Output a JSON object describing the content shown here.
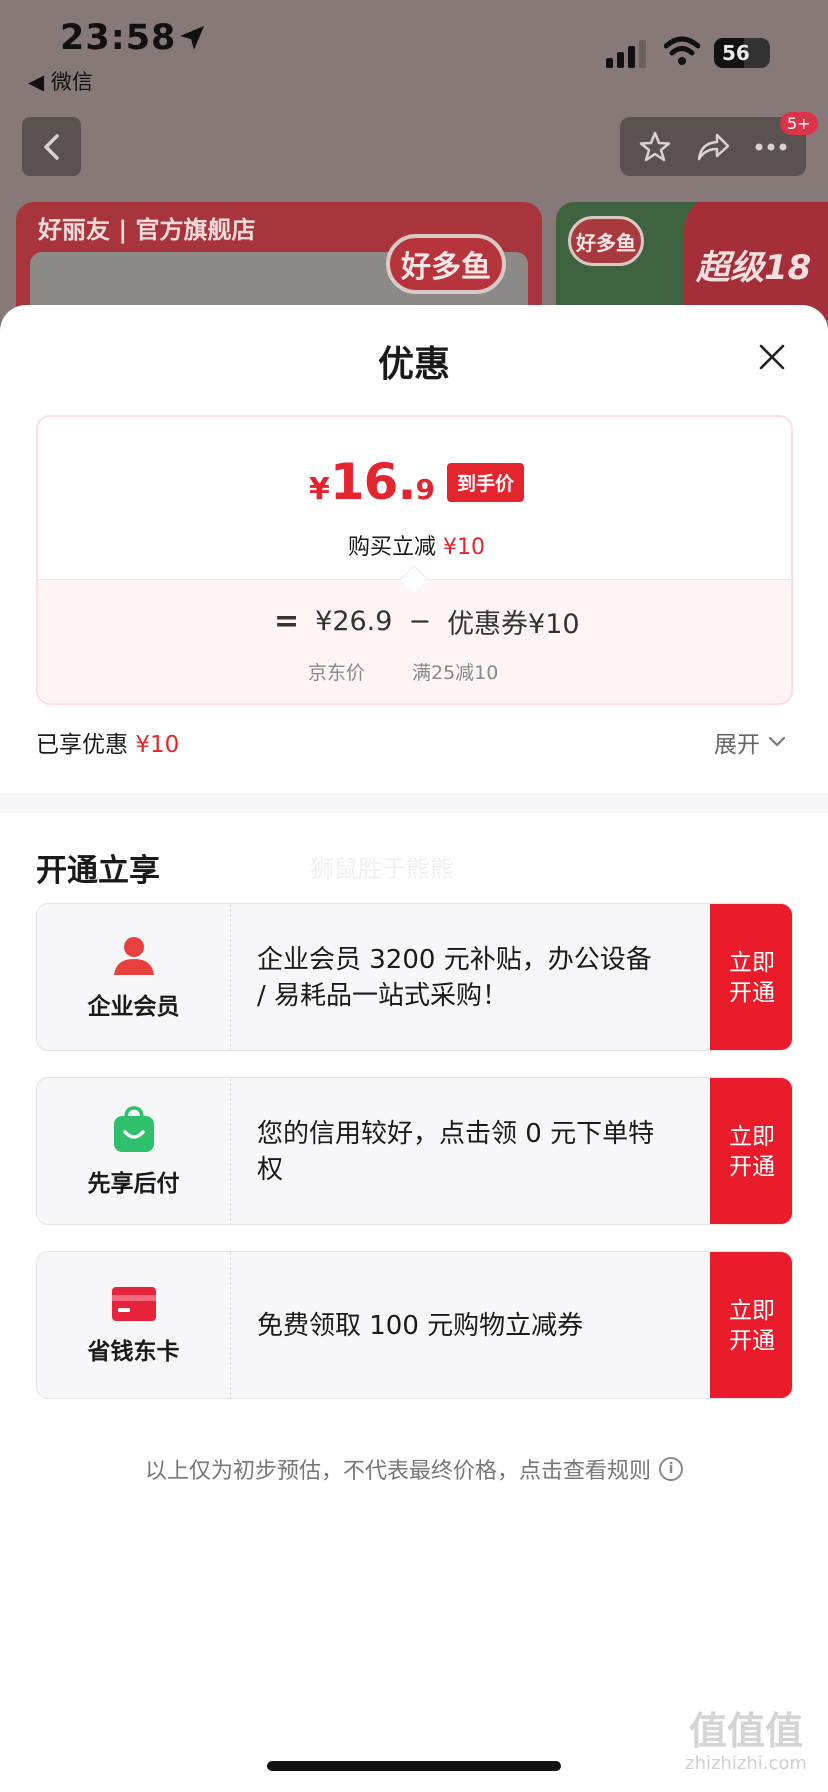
{
  "status_bar": {
    "time": "23:58",
    "back_app": "◀ 微信",
    "battery": "56"
  },
  "nav": {
    "badge": "5+"
  },
  "background": {
    "store_name": "好丽友 | 官方旗舰店",
    "logo_text": "好多鱼",
    "logo_text_2": "好多鱼",
    "promo_text": "超级18"
  },
  "sheet": {
    "title": "优惠",
    "price": {
      "yen": "¥",
      "integer": "16.",
      "decimal": "9",
      "tag": "到手价"
    },
    "save": {
      "label": "购买立减",
      "amount": "¥10"
    },
    "calc": {
      "equals": "=",
      "jd_price": "¥26.9",
      "minus": "−",
      "coupon": "优惠券¥10",
      "jd_label": "京东价",
      "coupon_rule": "满25减10"
    },
    "enjoyed": {
      "label": "已享优惠",
      "amount": "¥10"
    },
    "expand_label": "展开",
    "section_title": "开通立享",
    "watermark": "狮鼠胜于熊熊",
    "offers": [
      {
        "name": "企业会员",
        "icon": "person-icon",
        "desc": "企业会员 3200 元补贴，办公设备 / 易耗品一站式采购！",
        "button": "立即开通",
        "icon_color": "#e8413d"
      },
      {
        "name": "先享后付",
        "icon": "shopping-bag-icon",
        "desc": "您的信用较好，点击领 0 元下单特权",
        "button": "立即开通",
        "icon_color": "#2fc06b"
      },
      {
        "name": "省钱东卡",
        "icon": "card-icon",
        "desc": "免费领取 100 元购物立减券",
        "button": "立即开通",
        "icon_color": "#e8243c"
      }
    ],
    "disclaimer": "以上仅为初步预估，不代表最终价格，点击查看规则",
    "info_glyph": "i"
  },
  "site_watermark": {
    "big": "值值值",
    "small": "zhizhizhi.com"
  },
  "colors": {
    "accent_red": "#e5252d",
    "button_red": "#ea1c2c",
    "tint": "#fff5f6"
  }
}
